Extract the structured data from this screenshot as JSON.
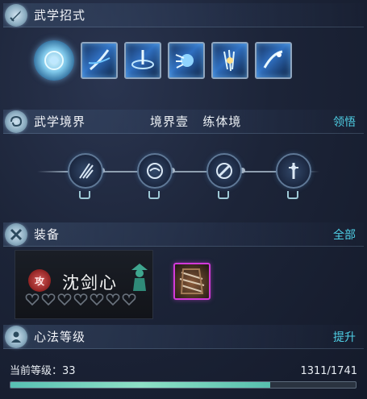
{
  "sections": {
    "martial_moves": {
      "title": "武学招式"
    },
    "martial_realm": {
      "title": "武学境界",
      "realm_level": "境界壹",
      "realm_name": "练体境",
      "action": "领悟"
    },
    "equipment": {
      "title": "装备",
      "action": "全部",
      "card_name": "沈剑心",
      "seal_text": "攻",
      "hearts_total": 7,
      "item_border_color": "#d23ad9"
    },
    "mental_method": {
      "title": "心法等级",
      "action": "提升",
      "level_label": "当前等级：33",
      "exp_text": "1311/1741",
      "progress": 0.753
    }
  },
  "colors": {
    "accent_link": "#4fd0e6",
    "progress_fill": "#6fd0bc"
  },
  "icons": [
    "sword-icon",
    "spiral-icon",
    "crossed-pillars-icon",
    "sword-hilt-icon",
    "person-icon"
  ]
}
